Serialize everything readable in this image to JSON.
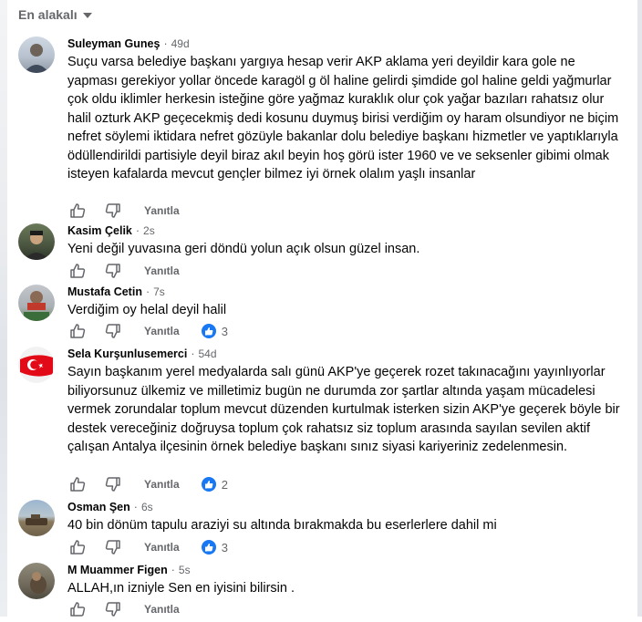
{
  "sort": {
    "label": "En alakalı"
  },
  "actions": {
    "reply_label": "Yanıtla"
  },
  "colors": {
    "reaction_blue": "#1877f2",
    "meta_gray": "#65676b"
  },
  "comments": [
    {
      "author": "Suleyman Guneş",
      "time": "49d",
      "text": "Suçu varsa belediye başkanı yargıya hesap verir AKP aklama yeri deyildir kara gole ne yapması gerekiyor yollar öncede karagöl g öl haline gelirdi şimdide gol haline geldi yağmurlar çok oldu iklimler herkesin isteğine göre yağmaz kuraklık olur çok yağar bazıları rahatsız olur halil ozturk AKP geçecekmiş dedi kosunu duymuş birisi verdiğim oy haram olsundiyor ne biçim nefret söylemi iktidara nefret gözüyle bakanlar dolu belediye başkanı hizmetler ve yaptıklarıyla ödüllendirildi partisiyle deyil biraz akıl beyin hoş görü ister 1960 ve ve seksenler gibimi olmak isteyen kafalarda mevcut gençler bilmez iyi örnek olalım yaşlı insanlar",
      "reactions": ""
    },
    {
      "author": "Kasim Çelik",
      "time": "2s",
      "text": "Yeni değil yuvasına geri döndü yolun açık olsun güzel insan.",
      "reactions": ""
    },
    {
      "author": "Mustafa Cetin",
      "time": "7s",
      "text": "Verdiğim oy helal deyil halil",
      "reactions": "3"
    },
    {
      "author": "Sela Kurşunlusemerci",
      "time": "54d",
      "text": "Sayın başkanım yerel medyalarda salı günü AKP'ye geçerek rozet takınacağını yayınlıyorlar biliyorsunuz ülkemiz ve milletimiz bugün ne durumda zor şartlar altında yaşam mücadelesi vermek zorundalar toplum mevcut düzenden kurtulmak isterken sizin AKP'ye geçerek böyle bir destek vereceğiniz doğruysa toplum çok rahatsız siz toplum arasında sayılan sevilen aktif çalışan Antalya ilçesinin örnek belediye başkanı sınız siyasi kariyeriniz zedelenmesin.",
      "reactions": "2"
    },
    {
      "author": "Osman Şen",
      "time": "6s",
      "text": "40 bin dönüm tapulu araziyi su altında bırakmakda bu eserlerlere dahil mi",
      "reactions": "3"
    },
    {
      "author": "M Muammer Figen",
      "time": "5s",
      "text": "ALLAH,ın izniyle Sen en iyisini bilirsin .",
      "reactions": ""
    }
  ]
}
